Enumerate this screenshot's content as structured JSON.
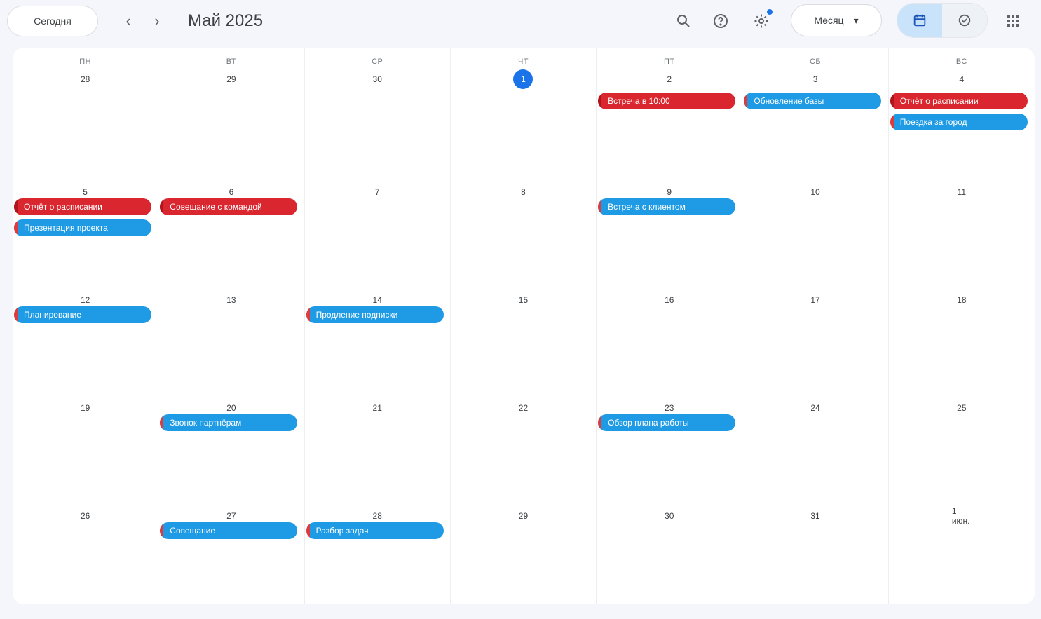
{
  "toolbar": {
    "today_label": "Сегодня",
    "prev_label": "‹",
    "next_label": "›",
    "title": "Май 2025",
    "view_label": "Месяц",
    "view_caret": "▾"
  },
  "icons": {
    "search": "search-icon",
    "help": "help-icon",
    "settings": "settings-icon",
    "calendar_view": "calendar-icon",
    "tasks_view": "check-circle-icon",
    "apps": "apps-grid-icon"
  },
  "colors": {
    "accent": "#1a73e8",
    "event_red": "#d9262f",
    "event_blue": "#1e9be4"
  },
  "calendar": {
    "weekdays": [
      "ПН",
      "ВТ",
      "СР",
      "ЧТ",
      "ПТ",
      "СБ",
      "ВС"
    ],
    "today_index": [
      0,
      3
    ],
    "weeks": [
      {
        "days": [
          {
            "date": "28",
            "events": []
          },
          {
            "date": "29",
            "events": []
          },
          {
            "date": "30",
            "events": []
          },
          {
            "date": "1",
            "events": []
          },
          {
            "date": "2",
            "events": [
              {
                "title": "Встреча в 10:00",
                "color": "red"
              }
            ]
          },
          {
            "date": "3",
            "events": [
              {
                "title": "Обновление базы",
                "color": "blue"
              }
            ]
          },
          {
            "date": "4",
            "events": [
              {
                "title": "Отчёт о расписании",
                "color": "red"
              },
              {
                "title": "Поездка за город",
                "color": "blue"
              }
            ]
          }
        ]
      },
      {
        "days": [
          {
            "date": "5",
            "events": [
              {
                "title": "Отчёт о расписании",
                "color": "red"
              },
              {
                "title": "Презентация проекта",
                "color": "blue"
              }
            ]
          },
          {
            "date": "6",
            "events": [
              {
                "title": "Совещание с командой",
                "color": "red"
              }
            ]
          },
          {
            "date": "7",
            "events": []
          },
          {
            "date": "8",
            "events": []
          },
          {
            "date": "9",
            "events": [
              {
                "title": "Встреча с клиентом",
                "color": "blue"
              }
            ]
          },
          {
            "date": "10",
            "events": []
          },
          {
            "date": "11",
            "events": []
          }
        ]
      },
      {
        "days": [
          {
            "date": "12",
            "events": [
              {
                "title": "Планирование",
                "color": "blue"
              }
            ]
          },
          {
            "date": "13",
            "events": []
          },
          {
            "date": "14",
            "events": [
              {
                "title": "Продление подписки",
                "color": "blue"
              }
            ]
          },
          {
            "date": "15",
            "events": []
          },
          {
            "date": "16",
            "events": []
          },
          {
            "date": "17",
            "events": []
          },
          {
            "date": "18",
            "events": []
          }
        ]
      },
      {
        "days": [
          {
            "date": "19",
            "events": []
          },
          {
            "date": "20",
            "events": [
              {
                "title": "Звонок партнёрам",
                "color": "blue"
              }
            ]
          },
          {
            "date": "21",
            "events": []
          },
          {
            "date": "22",
            "events": []
          },
          {
            "date": "23",
            "events": [
              {
                "title": "Обзор плана работы",
                "color": "blue"
              }
            ]
          },
          {
            "date": "24",
            "events": []
          },
          {
            "date": "25",
            "events": []
          }
        ]
      },
      {
        "days": [
          {
            "date": "26",
            "events": []
          },
          {
            "date": "27",
            "events": [
              {
                "title": "Совещание",
                "color": "blue"
              }
            ]
          },
          {
            "date": "28",
            "events": [
              {
                "title": "Разбор задач",
                "color": "blue"
              }
            ]
          },
          {
            "date": "29",
            "events": []
          },
          {
            "date": "30",
            "events": []
          },
          {
            "date": "31",
            "events": []
          },
          {
            "date": "1 июн.",
            "events": []
          }
        ]
      }
    ]
  }
}
